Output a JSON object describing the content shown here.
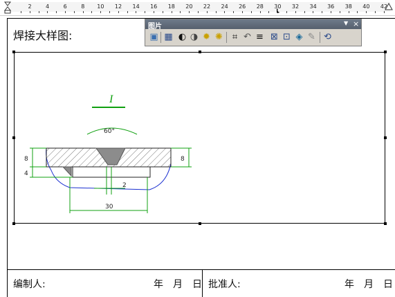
{
  "ruler": {
    "numbers": [
      "2",
      "4",
      "6",
      "8",
      "10",
      "12",
      "14",
      "16",
      "18",
      "20",
      "22",
      "24",
      "26",
      "28",
      "30",
      "32",
      "34",
      "36",
      "38",
      "40",
      "42"
    ]
  },
  "document": {
    "heading": "焊接大样图:",
    "prepared_by_label": "编制人:",
    "approved_by_label": "批准人:",
    "date_left": "年　月　日",
    "date_right": "年　月　日"
  },
  "drawing": {
    "section_mark": "I",
    "angle_label": "60°",
    "dim_left_top": "8",
    "dim_left_bottom": "4",
    "dim_right": "8",
    "dim_gap": "2",
    "dim_width": "30"
  },
  "picture_toolbar": {
    "title": "图片",
    "buttons": [
      {
        "name": "insert-picture-icon"
      },
      {
        "name": "color-icon"
      },
      {
        "name": "more-contrast-icon"
      },
      {
        "name": "less-contrast-icon"
      },
      {
        "name": "more-brightness-icon"
      },
      {
        "name": "less-brightness-icon"
      },
      {
        "name": "crop-icon"
      },
      {
        "name": "rotate-left-icon"
      },
      {
        "name": "line-style-icon"
      },
      {
        "name": "compress-pictures-icon"
      },
      {
        "name": "text-wrapping-icon"
      },
      {
        "name": "format-picture-icon"
      },
      {
        "name": "set-transparent-color-icon"
      },
      {
        "name": "reset-picture-icon"
      }
    ]
  },
  "colors": {
    "dimension_green": "#10a010",
    "outline_blue": "#1a2fd0",
    "weld_gray": "#8c8c8c",
    "toolbar_bg": "#d8d4cc"
  }
}
